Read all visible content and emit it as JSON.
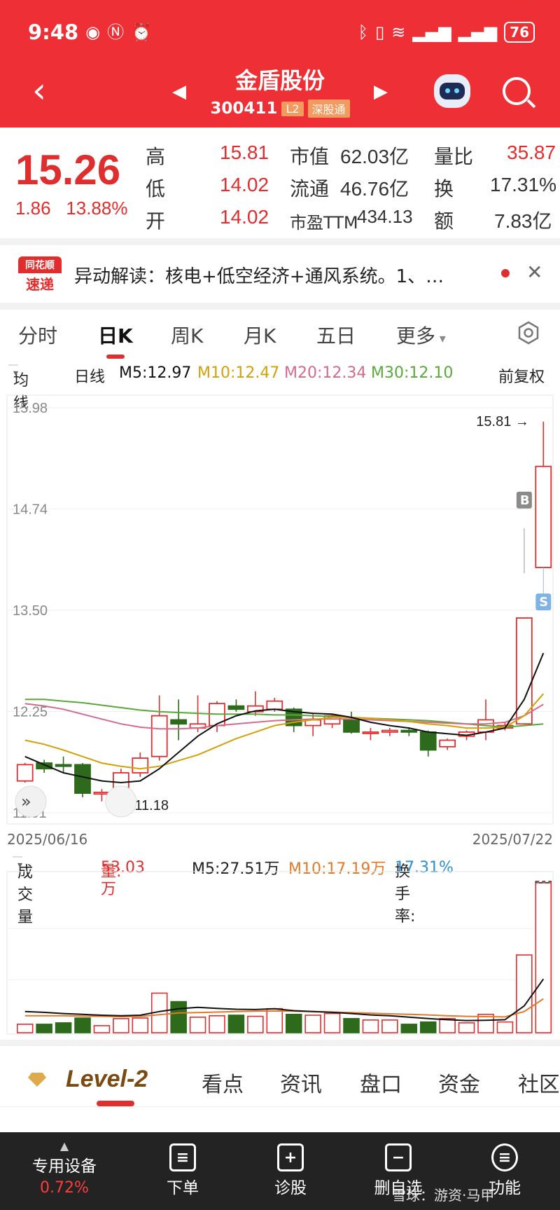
{
  "status": {
    "time": "9:48",
    "battery": "76"
  },
  "header": {
    "stock_name": "金盾股份",
    "stock_code": "300411",
    "tag_l2": "L2",
    "tag_connect": "深股通"
  },
  "quote": {
    "price": "15.26",
    "change": "1.86",
    "change_pct": "13.88%",
    "high_label": "高",
    "high": "15.81",
    "low_label": "低",
    "low": "14.02",
    "open_label": "开",
    "open": "14.02",
    "mktcap_label": "市值",
    "mktcap": "62.03亿",
    "float_label": "流通",
    "float": "46.76亿",
    "pe_label": "市盈TTM",
    "pe": "434.13",
    "vr_label": "量比",
    "vr": "35.87",
    "turnover_label": "换",
    "turnover": "17.31%",
    "amount_label": "额",
    "amount": "7.83亿"
  },
  "notice": {
    "logo_top": "同花顺",
    "logo_bottom": "速递",
    "text": "异动解读：核电+低空经济+通风系统。1、…"
  },
  "tabs": [
    "分时",
    "日K",
    "周K",
    "月K",
    "五日",
    "更多"
  ],
  "ma_row": {
    "dropdown": "均线",
    "period": "日线",
    "m5": "M5:12.97",
    "m10": "M10:12.47",
    "m20": "M20:12.34",
    "m30": "M30:12.10",
    "adjust": "前复权"
  },
  "axis": {
    "y_labels": [
      "15.98",
      "14.74",
      "13.50",
      "12.25",
      "11.01"
    ],
    "date_start": "2025/06/16",
    "date_end": "2025/07/22",
    "max_note": "15.81",
    "min_note": "11.18",
    "buy_marker": "B",
    "sell_marker": "S"
  },
  "volume_row": {
    "dropdown": "成交量",
    "vol_label": "量:",
    "vol": "53.03万",
    "m5": "M5:27.51万",
    "m10": "M10:17.19万",
    "turnover_label": "换手率:",
    "turnover": "17.31%"
  },
  "level2": {
    "logo": "Level-2",
    "tabs": [
      "看点",
      "资讯",
      "盘口",
      "资金",
      "社区"
    ]
  },
  "bottom_nav": {
    "device": "专用设备",
    "device_pct": "0.72%",
    "order": "下单",
    "diagnose": "诊股",
    "remove": "删自选",
    "function": "功能"
  },
  "watermark": "雪球：游资·马甲",
  "colors": {
    "up": "#e02d2d",
    "down": "#2d6a1b",
    "ma5": "#111111",
    "ma10": "#d4a00a",
    "ma20": "#d46b8a",
    "ma30": "#5aa83a",
    "header": "#ee2f36"
  },
  "chart_data": {
    "type": "candlestick",
    "y_range": [
      11.01,
      15.98
    ],
    "candles": [
      {
        "o": 11.4,
        "c": 11.6,
        "h": 11.62,
        "l": 11.38
      },
      {
        "o": 11.62,
        "c": 11.55,
        "h": 11.66,
        "l": 11.5
      },
      {
        "o": 11.6,
        "c": 11.58,
        "h": 11.7,
        "l": 11.5
      },
      {
        "o": 11.6,
        "c": 11.25,
        "h": 11.62,
        "l": 11.2
      },
      {
        "o": 11.24,
        "c": 11.26,
        "h": 11.3,
        "l": 11.15
      },
      {
        "o": 11.2,
        "c": 11.5,
        "h": 11.55,
        "l": 11.18
      },
      {
        "o": 11.5,
        "c": 11.68,
        "h": 11.75,
        "l": 11.45
      },
      {
        "o": 11.7,
        "c": 12.2,
        "h": 12.45,
        "l": 11.65
      },
      {
        "o": 12.15,
        "c": 12.1,
        "h": 12.4,
        "l": 11.9
      },
      {
        "o": 12.05,
        "c": 12.1,
        "h": 12.45,
        "l": 12.0
      },
      {
        "o": 12.08,
        "c": 12.35,
        "h": 12.38,
        "l": 12.0
      },
      {
        "o": 12.32,
        "c": 12.28,
        "h": 12.4,
        "l": 12.25
      },
      {
        "o": 12.25,
        "c": 12.32,
        "h": 12.5,
        "l": 12.2
      },
      {
        "o": 12.28,
        "c": 12.38,
        "h": 12.42,
        "l": 12.25
      },
      {
        "o": 12.28,
        "c": 12.08,
        "h": 12.3,
        "l": 12.0
      },
      {
        "o": 12.08,
        "c": 12.15,
        "h": 12.22,
        "l": 11.95
      },
      {
        "o": 12.1,
        "c": 12.2,
        "h": 12.22,
        "l": 12.05
      },
      {
        "o": 12.15,
        "c": 12.0,
        "h": 12.25,
        "l": 11.98
      },
      {
        "o": 12.0,
        "c": 12.0,
        "h": 12.05,
        "l": 11.9
      },
      {
        "o": 12.0,
        "c": 12.02,
        "h": 12.05,
        "l": 11.95
      },
      {
        "o": 12.02,
        "c": 12.0,
        "h": 12.06,
        "l": 11.95
      },
      {
        "o": 12.0,
        "c": 11.78,
        "h": 12.02,
        "l": 11.7
      },
      {
        "o": 11.82,
        "c": 11.9,
        "h": 11.92,
        "l": 11.78
      },
      {
        "o": 11.95,
        "c": 12.0,
        "h": 12.02,
        "l": 11.9
      },
      {
        "o": 12.0,
        "c": 12.15,
        "h": 12.4,
        "l": 11.9
      },
      {
        "o": 12.05,
        "c": 12.08,
        "h": 12.12,
        "l": 12.02
      },
      {
        "o": 12.1,
        "c": 13.4,
        "h": 13.4,
        "l": 12.1
      },
      {
        "o": 14.02,
        "c": 15.26,
        "h": 15.81,
        "l": 14.02
      }
    ],
    "ma5": [
      11.7,
      11.6,
      11.5,
      11.45,
      11.4,
      11.38,
      11.4,
      11.55,
      11.75,
      11.95,
      12.1,
      12.2,
      12.26,
      12.28,
      12.25,
      12.23,
      12.22,
      12.18,
      12.12,
      12.08,
      12.05,
      12.0,
      11.98,
      11.96,
      12.0,
      12.05,
      12.4,
      12.97
    ],
    "ma10": [
      11.9,
      11.85,
      11.78,
      11.7,
      11.62,
      11.58,
      11.55,
      11.58,
      11.65,
      11.72,
      11.82,
      11.92,
      12.0,
      12.08,
      12.12,
      12.15,
      12.18,
      12.18,
      12.17,
      12.15,
      12.13,
      12.1,
      12.08,
      12.05,
      12.05,
      12.06,
      12.2,
      12.47
    ],
    "ma20": [
      12.35,
      12.32,
      12.28,
      12.22,
      12.16,
      12.1,
      12.06,
      12.04,
      12.04,
      12.05,
      12.08,
      12.1,
      12.12,
      12.14,
      12.15,
      12.16,
      12.16,
      12.16,
      12.15,
      12.14,
      12.13,
      12.12,
      12.11,
      12.1,
      12.1,
      12.12,
      12.2,
      12.34
    ],
    "ma30": [
      12.4,
      12.4,
      12.38,
      12.36,
      12.33,
      12.3,
      12.27,
      12.25,
      12.24,
      12.23,
      12.22,
      12.22,
      12.22,
      12.21,
      12.21,
      12.2,
      12.19,
      12.18,
      12.17,
      12.16,
      12.15,
      12.14,
      12.12,
      12.1,
      12.08,
      12.06,
      12.08,
      12.1
    ],
    "volume": [
      3.0,
      3.0,
      3.5,
      5.2,
      2.5,
      5.0,
      5.2,
      14.0,
      11.0,
      5.5,
      6.0,
      6.2,
      5.8,
      8.5,
      6.5,
      6.2,
      6.8,
      5.0,
      4.5,
      4.5,
      3.0,
      3.8,
      5.0,
      3.5,
      6.5,
      3.8,
      27.5,
      53.03
    ],
    "vol_ma5": [
      7.5,
      7.2,
      6.8,
      6.5,
      6.2,
      6.0,
      6.2,
      7.5,
      8.5,
      9.0,
      8.6,
      8.3,
      8.2,
      8.5,
      7.8,
      7.5,
      7.2,
      6.8,
      6.3,
      6.0,
      5.5,
      5.0,
      4.6,
      4.3,
      4.4,
      4.6,
      9.5,
      19.0
    ],
    "vol_ma10": [
      6.0,
      6.0,
      6.0,
      5.9,
      5.8,
      5.7,
      5.8,
      6.4,
      7.0,
      7.1,
      7.3,
      7.5,
      7.6,
      7.7,
      7.6,
      7.5,
      7.3,
      7.1,
      6.9,
      6.7,
      6.5,
      6.3,
      6.0,
      5.8,
      5.7,
      5.6,
      7.5,
      12.0
    ],
    "vol_max": 55
  }
}
